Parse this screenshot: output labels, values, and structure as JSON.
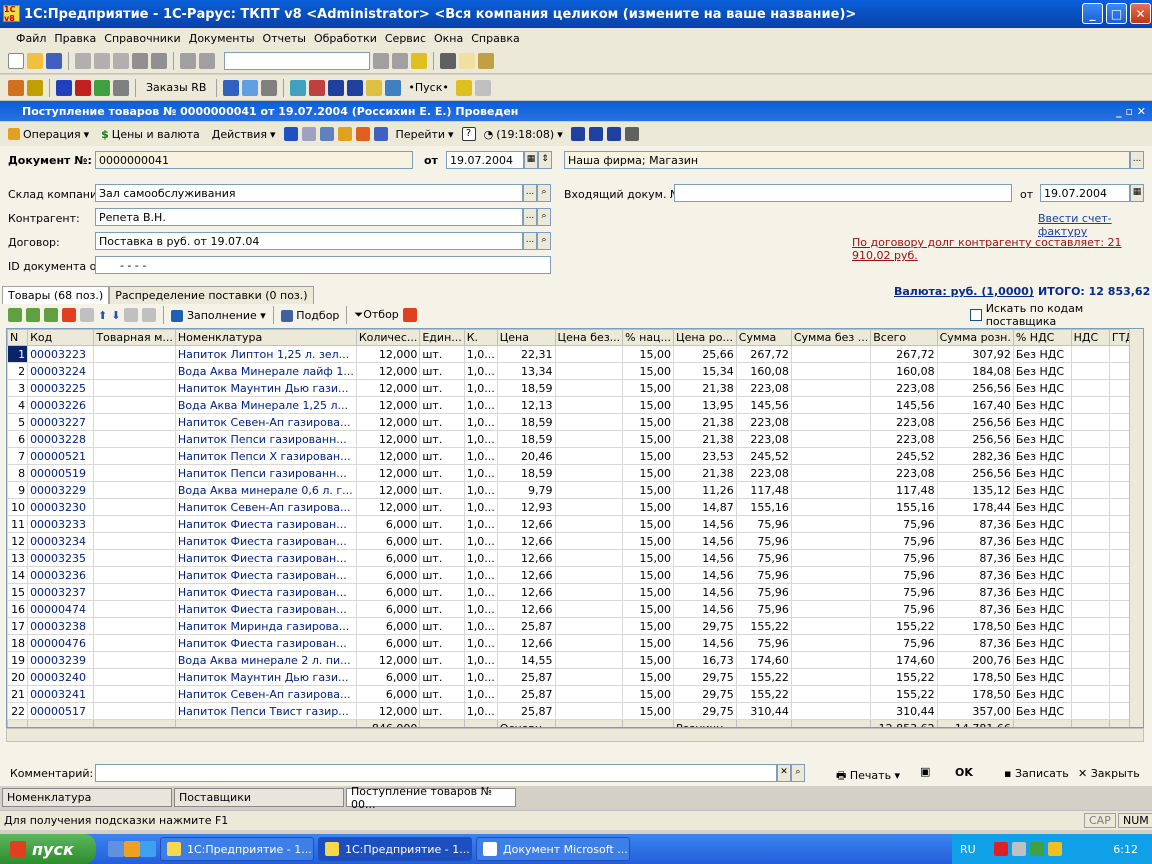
{
  "window": {
    "title": "1С:Предприятие - 1С-Рарус: ТКПТ v8 <Administrator> <Вся компания целиком (измените на ваше название)>",
    "min": "_",
    "max": "□",
    "close": "✕",
    "logo": "1С v8"
  },
  "menu": [
    "Файл",
    "Правка",
    "Справочники",
    "Документы",
    "Отчеты",
    "Обработки",
    "Сервис",
    "Окна",
    "Справка"
  ],
  "toolbar2": {
    "orders": "Заказы RB",
    "start": "•Пуск•"
  },
  "doc": {
    "title": "Поступление товаров № 0000000041 от 19.07.2004 (Россихин Е. Е.) Проведен",
    "toolbar": {
      "operation": "Операция",
      "prices": "Цены и валюта",
      "actions": "Действия",
      "goto": "Перейти",
      "time": "(19:18:08)"
    },
    "number_label": "Документ №:",
    "number": "0000000041",
    "from_label": "от",
    "date": "19.07.2004",
    "firm": "Наша фирма; Магазин",
    "warehouse_label": "Склад компании:",
    "warehouse": "Зал самообслуживания",
    "contractor_label": "Контрагент:",
    "contractor": "Репета В.Н.",
    "contract_label": "Договор:",
    "contract": "Поставка в руб. от 19.07.04",
    "id_label": "ID документа о...",
    "id_value": "-   -   -   -",
    "incoming_label": "Входящий докум. №:",
    "incoming": "",
    "incoming_from": "от",
    "incoming_date": "19.07.2004",
    "invoice_link": "Ввести счет-фактуру",
    "debt_link": "По договору долг контрагенту составляет: 21 910,02 руб.",
    "currency": "Валюта: руб. (1,0000)",
    "total": "ИТОГО: 12 853,62"
  },
  "tabs": [
    "Товары (68 поз.)",
    "Распределение поставки (0 поз.)"
  ],
  "gridtb": {
    "fill": "Заполнение",
    "pick": "Подбор",
    "filter": "Отбор",
    "search_check": "Искать по кодам поставщика"
  },
  "columns": [
    "N",
    "Код",
    "Товарная м...",
    "Номенклатура",
    "Количес...",
    "Един...",
    "К.",
    "Цена",
    "Цена без...",
    "% нац...",
    "Цена ро...",
    "Сумма",
    "Сумма без ...",
    "Всего",
    "Сумма розн.",
    "% НДС",
    "НДС",
    "ГТД"
  ],
  "rows": [
    [
      "1",
      "00003223",
      "",
      "Напиток Липтон 1,25 л. зел...",
      "12,000",
      "шт.",
      "1,0...",
      "22,31",
      "",
      "15,00",
      "25,66",
      "267,72",
      "",
      "267,72",
      "307,92",
      "Без НДС",
      "",
      ""
    ],
    [
      "2",
      "00003224",
      "",
      "Вода Аква Минерале лайф 1...",
      "12,000",
      "шт.",
      "1,0...",
      "13,34",
      "",
      "15,00",
      "15,34",
      "160,08",
      "",
      "160,08",
      "184,08",
      "Без НДС",
      "",
      ""
    ],
    [
      "3",
      "00003225",
      "",
      "Напиток Маунтин Дью гази...",
      "12,000",
      "шт.",
      "1,0...",
      "18,59",
      "",
      "15,00",
      "21,38",
      "223,08",
      "",
      "223,08",
      "256,56",
      "Без НДС",
      "",
      ""
    ],
    [
      "4",
      "00003226",
      "",
      "Вода Аква Минерале 1,25 л...",
      "12,000",
      "шт.",
      "1,0...",
      "12,13",
      "",
      "15,00",
      "13,95",
      "145,56",
      "",
      "145,56",
      "167,40",
      "Без НДС",
      "",
      ""
    ],
    [
      "5",
      "00003227",
      "",
      "Напиток Севен-Ап газирова...",
      "12,000",
      "шт.",
      "1,0...",
      "18,59",
      "",
      "15,00",
      "21,38",
      "223,08",
      "",
      "223,08",
      "256,56",
      "Без НДС",
      "",
      ""
    ],
    [
      "6",
      "00003228",
      "",
      "Напиток Пепси газированн...",
      "12,000",
      "шт.",
      "1,0...",
      "18,59",
      "",
      "15,00",
      "21,38",
      "223,08",
      "",
      "223,08",
      "256,56",
      "Без НДС",
      "",
      ""
    ],
    [
      "7",
      "00000521",
      "",
      "Напиток Пепси Х газирован...",
      "12,000",
      "шт.",
      "1,0...",
      "20,46",
      "",
      "15,00",
      "23,53",
      "245,52",
      "",
      "245,52",
      "282,36",
      "Без НДС",
      "",
      ""
    ],
    [
      "8",
      "00000519",
      "",
      "Напиток Пепси газированн...",
      "12,000",
      "шт.",
      "1,0...",
      "18,59",
      "",
      "15,00",
      "21,38",
      "223,08",
      "",
      "223,08",
      "256,56",
      "Без НДС",
      "",
      ""
    ],
    [
      "9",
      "00003229",
      "",
      "Вода Аква минерале 0,6 л. г...",
      "12,000",
      "шт.",
      "1,0...",
      "9,79",
      "",
      "15,00",
      "11,26",
      "117,48",
      "",
      "117,48",
      "135,12",
      "Без НДС",
      "",
      ""
    ],
    [
      "10",
      "00003230",
      "",
      "Напиток Севен-Ап газирова...",
      "12,000",
      "шт.",
      "1,0...",
      "12,93",
      "",
      "15,00",
      "14,87",
      "155,16",
      "",
      "155,16",
      "178,44",
      "Без НДС",
      "",
      ""
    ],
    [
      "11",
      "00003233",
      "",
      "Напиток Фиеста газирован...",
      "6,000",
      "шт.",
      "1,0...",
      "12,66",
      "",
      "15,00",
      "14,56",
      "75,96",
      "",
      "75,96",
      "87,36",
      "Без НДС",
      "",
      ""
    ],
    [
      "12",
      "00003234",
      "",
      "Напиток Фиеста газирован...",
      "6,000",
      "шт.",
      "1,0...",
      "12,66",
      "",
      "15,00",
      "14,56",
      "75,96",
      "",
      "75,96",
      "87,36",
      "Без НДС",
      "",
      ""
    ],
    [
      "13",
      "00003235",
      "",
      "Напиток Фиеста газирован...",
      "6,000",
      "шт.",
      "1,0...",
      "12,66",
      "",
      "15,00",
      "14,56",
      "75,96",
      "",
      "75,96",
      "87,36",
      "Без НДС",
      "",
      ""
    ],
    [
      "14",
      "00003236",
      "",
      "Напиток Фиеста газирован...",
      "6,000",
      "шт.",
      "1,0...",
      "12,66",
      "",
      "15,00",
      "14,56",
      "75,96",
      "",
      "75,96",
      "87,36",
      "Без НДС",
      "",
      ""
    ],
    [
      "15",
      "00003237",
      "",
      "Напиток Фиеста газирован...",
      "6,000",
      "шт.",
      "1,0...",
      "12,66",
      "",
      "15,00",
      "14,56",
      "75,96",
      "",
      "75,96",
      "87,36",
      "Без НДС",
      "",
      ""
    ],
    [
      "16",
      "00000474",
      "",
      "Напиток Фиеста газирован...",
      "6,000",
      "шт.",
      "1,0...",
      "12,66",
      "",
      "15,00",
      "14,56",
      "75,96",
      "",
      "75,96",
      "87,36",
      "Без НДС",
      "",
      ""
    ],
    [
      "17",
      "00003238",
      "",
      "Напиток Миринда газирова...",
      "6,000",
      "шт.",
      "1,0...",
      "25,87",
      "",
      "15,00",
      "29,75",
      "155,22",
      "",
      "155,22",
      "178,50",
      "Без НДС",
      "",
      ""
    ],
    [
      "18",
      "00000476",
      "",
      "Напиток Фиеста газирован...",
      "6,000",
      "шт.",
      "1,0...",
      "12,66",
      "",
      "15,00",
      "14,56",
      "75,96",
      "",
      "75,96",
      "87,36",
      "Без НДС",
      "",
      ""
    ],
    [
      "19",
      "00003239",
      "",
      "Вода Аква минерале 2 л. пи...",
      "12,000",
      "шт.",
      "1,0...",
      "14,55",
      "",
      "15,00",
      "16,73",
      "174,60",
      "",
      "174,60",
      "200,76",
      "Без НДС",
      "",
      ""
    ],
    [
      "20",
      "00003240",
      "",
      "Напиток Маунтин Дью гази...",
      "6,000",
      "шт.",
      "1,0...",
      "25,87",
      "",
      "15,00",
      "29,75",
      "155,22",
      "",
      "155,22",
      "178,50",
      "Без НДС",
      "",
      ""
    ],
    [
      "21",
      "00003241",
      "",
      "Напиток Севен-Ап газирова...",
      "6,000",
      "шт.",
      "1,0...",
      "25,87",
      "",
      "15,00",
      "29,75",
      "155,22",
      "",
      "155,22",
      "178,50",
      "Без НДС",
      "",
      ""
    ],
    [
      "22",
      "00000517",
      "",
      "Напиток Пепси Твист газир...",
      "12,000",
      "шт.",
      "1,0...",
      "25,87",
      "",
      "15,00",
      "29,75",
      "310,44",
      "",
      "310,44",
      "357,00",
      "Без НДС",
      "",
      ""
    ]
  ],
  "footer": {
    "qty": "846,000",
    "price": "Основн...",
    "retail_price": "Розничн...",
    "total": "12 853,62",
    "retail_total": "14 781,66"
  },
  "bottom": {
    "comment_label": "Комментарий:",
    "print": "Печать",
    "ok": "OK",
    "save": "Записать",
    "close": "Закрыть"
  },
  "windows": [
    "Номенклатура",
    "Поставщики",
    "Поступление товаров № 00..."
  ],
  "status": {
    "hint": "Для получения подсказки нажмите F1",
    "cap": "CAP",
    "num": "NUM"
  },
  "taskbar": {
    "start": "пуск",
    "tasks": [
      "1С:Предприятие - 1...",
      "1С:Предприятие - 1...",
      "Документ Microsoft ..."
    ],
    "lang": "RU",
    "time": "6:12"
  }
}
